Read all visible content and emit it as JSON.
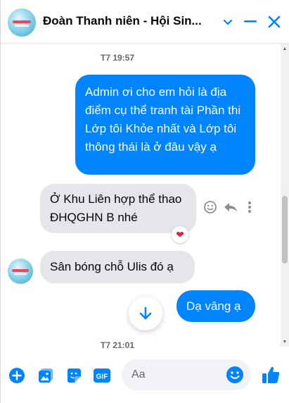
{
  "header": {
    "title": "Đoàn Thanh niên - Hội Sin...",
    "icons": [
      "group-avatar",
      "chevron-down-icon",
      "minimize-icon",
      "close-icon"
    ],
    "accent_color": "#0084ff"
  },
  "messages": [
    {
      "type": "timestamp",
      "text": "T7 19:57"
    },
    {
      "type": "outgoing",
      "text": "Admin ơi cho em hỏi là địa điểm cụ thể tranh tài Phần thi Lớp tôi Khỏe nhất và Lớp tôi thông thái là ở đâu vậy ạ"
    },
    {
      "type": "incoming",
      "text": "Ở Khu Liên hợp thể thao ĐHQGHN B nhé",
      "reaction": "heart"
    },
    {
      "type": "incoming",
      "text": "Sân bóng chỗ Ulis đó ạ"
    },
    {
      "type": "outgoing",
      "text": "Dạ vâng ạ"
    },
    {
      "type": "timestamp",
      "text": "T7 21:01"
    }
  ],
  "message_actions": [
    "emoji-react-icon",
    "reply-icon",
    "more-options-icon"
  ],
  "composer": {
    "placeholder": "Aa",
    "value": "",
    "tools": [
      "plus-icon",
      "photo-icon",
      "sticker-icon",
      "gif-icon"
    ],
    "gif_label": "GIF",
    "send_icon": "thumbs-up-icon"
  },
  "colors": {
    "outgoing_bubble": "#0084ff",
    "incoming_bubble": "#e4e6eb",
    "reaction_heart": "#e41e3f"
  }
}
